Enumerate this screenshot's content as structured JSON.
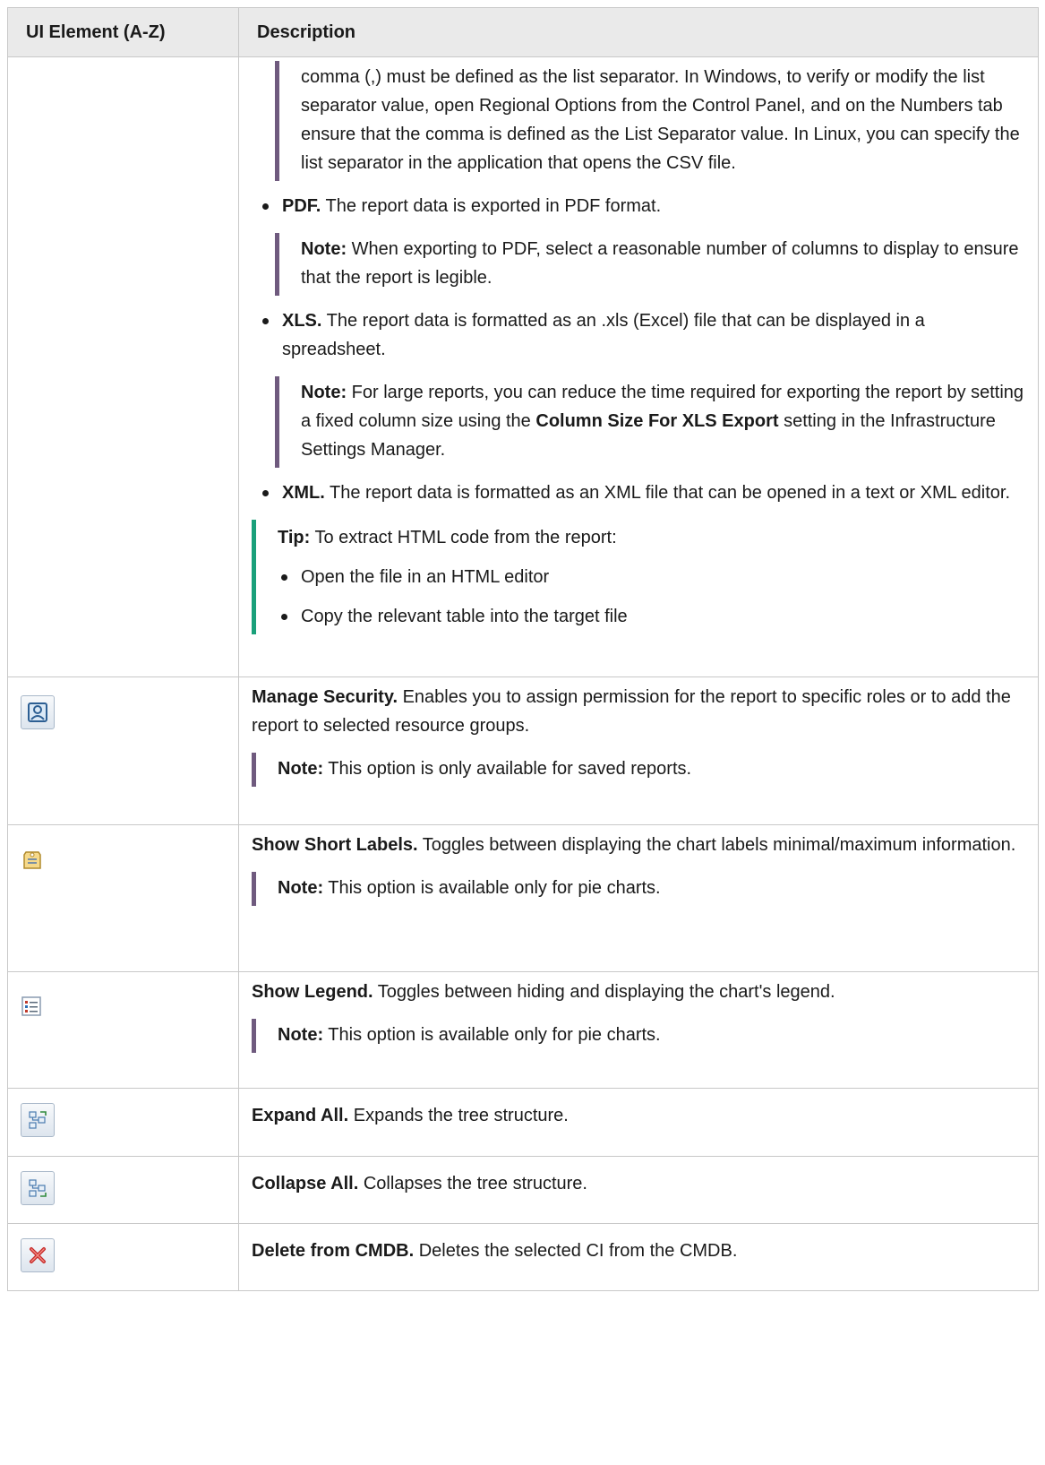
{
  "table": {
    "headers": [
      "UI Element (A-Z)",
      "Description"
    ]
  },
  "row_export": {
    "csv_note": "comma (,) must be defined as the list separator. In Windows, to verify or modify the list separator value, open Regional Options from the Control Panel, and on the Numbers tab ensure that the comma is defined as the List Separator value. In Linux, you can specify the list separator in the application that opens the CSV file.",
    "pdf_label": "PDF.",
    "pdf_text": " The report data is exported in PDF format.",
    "pdf_note_label": "Note:",
    "pdf_note_text": " When exporting to PDF, select a reasonable number of columns to display to ensure that the report is legible.",
    "xls_label": "XLS.",
    "xls_text": " The report data is formatted as an .xls (Excel) file that can be displayed in a spreadsheet.",
    "xls_note_label": "Note:",
    "xls_note_text_1": " For large reports, you can reduce the time required for exporting the report by setting a fixed column size using the ",
    "xls_note_bold": "Column Size For XLS Export",
    "xls_note_text_2": " setting in the Infrastructure Settings Manager.",
    "xml_label": "XML.",
    "xml_text": " The report data is formatted as an XML file that can be opened in a text or XML editor.",
    "tip_label": "Tip:",
    "tip_text": " To extract HTML code from the report:",
    "tip_items": [
      "Open the file in an HTML editor",
      "Copy the relevant table into the target file"
    ]
  },
  "rows": [
    {
      "icon": "manage-security-icon",
      "title": "Manage Security.",
      "text": " Enables you to assign permission for the report to specific roles or to add the report to selected resource groups.",
      "note_label": "Note:",
      "note_text": " This option is only available for saved reports."
    },
    {
      "icon": "show-short-labels-icon",
      "title": "Show Short Labels.",
      "text": " Toggles between displaying the chart labels minimal/maximum information.",
      "note_label": "Note:",
      "note_text": " This option is available only for pie charts."
    },
    {
      "icon": "show-legend-icon",
      "title": "Show Legend.",
      "text": " Toggles between hiding and displaying the chart's legend.",
      "note_label": "Note:",
      "note_text": " This option is available only for pie charts."
    },
    {
      "icon": "expand-all-icon",
      "title": "Expand All.",
      "text": " Expands the tree structure."
    },
    {
      "icon": "collapse-all-icon",
      "title": "Collapse All.",
      "text": " Collapses the tree structure."
    },
    {
      "icon": "delete-icon",
      "title": "Delete from CMDB.",
      "text": " Deletes the selected CI from the CMDB."
    }
  ],
  "colors": {
    "note_bar": "#6f5a7e",
    "tip_bar": "#1aa07a",
    "header_bg": "#eaeaea",
    "border": "#c8c8c8"
  }
}
